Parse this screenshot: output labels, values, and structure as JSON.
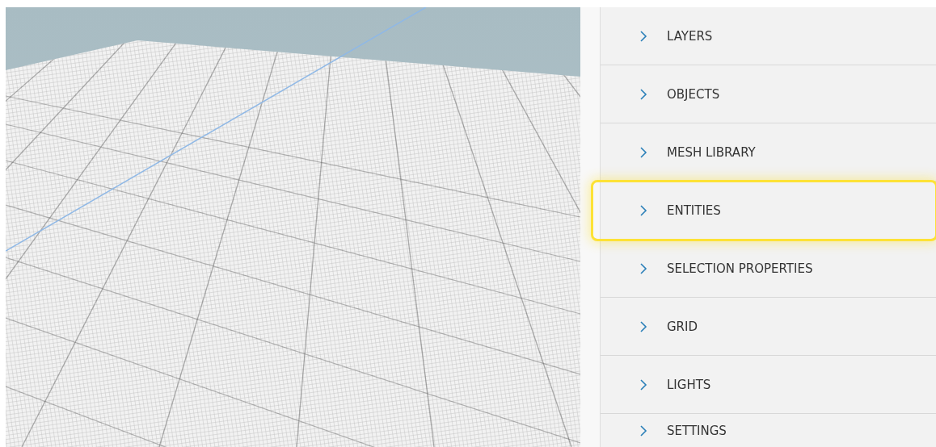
{
  "panel": {
    "sections": [
      {
        "label": "LAYERS",
        "expanded": false,
        "highlighted": false
      },
      {
        "label": "OBJECTS",
        "expanded": false,
        "highlighted": false
      },
      {
        "label": "MESH LIBRARY",
        "expanded": false,
        "highlighted": false
      },
      {
        "label": "ENTITIES",
        "expanded": false,
        "highlighted": true
      },
      {
        "label": "SELECTION PROPERTIES",
        "expanded": false,
        "highlighted": false
      },
      {
        "label": "GRID",
        "expanded": false,
        "highlighted": false
      },
      {
        "label": "LIGHTS",
        "expanded": false,
        "highlighted": false
      },
      {
        "label": "SETTINGS",
        "expanded": false,
        "highlighted": false
      }
    ]
  }
}
